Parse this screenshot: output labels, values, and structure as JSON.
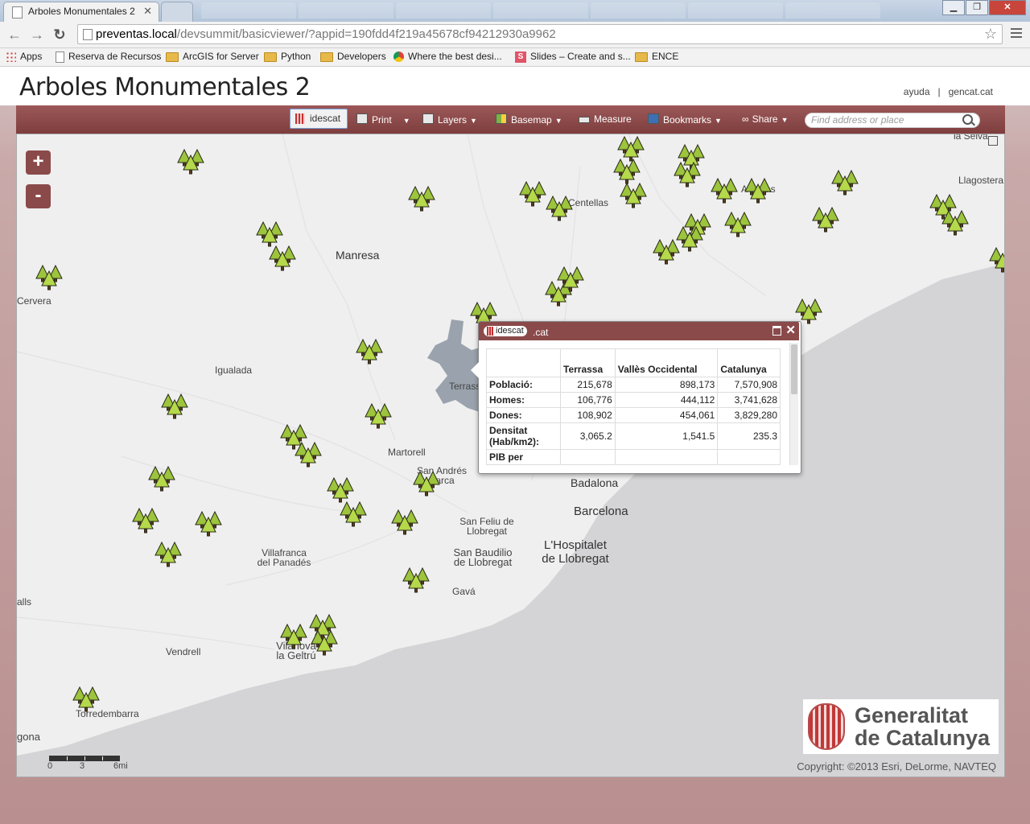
{
  "browser": {
    "tab_title": "Arboles Monumentales 2",
    "url_host": "preventas.local",
    "url_path": "/devsummit/basicviewer/?appid=190fdd4f219a45678cf94212930a9962",
    "bookmarks": [
      {
        "label": "Apps",
        "icon": "apps-icon"
      },
      {
        "label": "Reserva de Recursos",
        "icon": "page-icon"
      },
      {
        "label": "ArcGIS for Server",
        "icon": "folder-icon"
      },
      {
        "label": "Python",
        "icon": "folder-icon"
      },
      {
        "label": "Developers",
        "icon": "folder-icon"
      },
      {
        "label": "Where the best desi...",
        "icon": "chrome-icon"
      },
      {
        "label": "Slides – Create and s...",
        "icon": "slides-icon"
      },
      {
        "label": "ENCE",
        "icon": "folder-icon"
      }
    ]
  },
  "header": {
    "title": "Arboles Monumentales 2",
    "links": [
      "ayuda",
      "gencat.cat"
    ]
  },
  "toolbar": {
    "idescat": "idescat",
    "print": "Print",
    "layers": "Layers",
    "basemap": "Basemap",
    "measure": "Measure",
    "bookmarks": "Bookmarks",
    "share": "Share",
    "search_placeholder": "Find address or place"
  },
  "map": {
    "zoom_in": "+",
    "zoom_out": "-",
    "places": [
      {
        "name": "Centellas"
      },
      {
        "name": "Manresa"
      },
      {
        "name": "Cervera"
      },
      {
        "name": "Igualada"
      },
      {
        "name": "Martorell"
      },
      {
        "name": "San Andrés Barca"
      },
      {
        "name": "Badalona"
      },
      {
        "name": "Barcelona"
      },
      {
        "name": "San Feliu de Llobregat"
      },
      {
        "name": "L'Hospitalet de Llobregat"
      },
      {
        "name": "San Baudilio de Llobregat"
      },
      {
        "name": "Villafranca del Panadés"
      },
      {
        "name": "Gavá"
      },
      {
        "name": "Vendrell"
      },
      {
        "name": "Vilanova la Geltrú"
      },
      {
        "name": "Torredembarra"
      },
      {
        "name": "Llagostera"
      },
      {
        "name": "Terrassa"
      },
      {
        "name": "alls"
      },
      {
        "name": "gona"
      },
      {
        "name": "la Selva"
      },
      {
        "name": "A"
      },
      {
        "name": "as"
      }
    ],
    "scale_labels": [
      "0",
      "3",
      "6mi"
    ],
    "copyright": "Copyright: ©2013 Esri, DeLorme, NAVTEQ",
    "logo_line1": "Generalitat",
    "logo_line2": "de Catalunya"
  },
  "popup": {
    "logo": "idescat",
    "logo_suffix": ".cat",
    "columns": [
      "",
      "Terrassa",
      "Vallès Occidental",
      "Catalunya"
    ],
    "rows": [
      {
        "label": "Població:",
        "values": [
          "215,678",
          "898,173",
          "7,570,908"
        ]
      },
      {
        "label": "Homes:",
        "values": [
          "106,776",
          "444,112",
          "3,741,628"
        ]
      },
      {
        "label": "Dones:",
        "values": [
          "108,902",
          "454,061",
          "3,829,280"
        ]
      },
      {
        "label": "Densitat (Hab/km2):",
        "values": [
          "3,065.2",
          "1,541.5",
          "235.3"
        ]
      },
      {
        "label": "PIB per",
        "values": [
          "",
          "",
          ""
        ]
      }
    ]
  }
}
